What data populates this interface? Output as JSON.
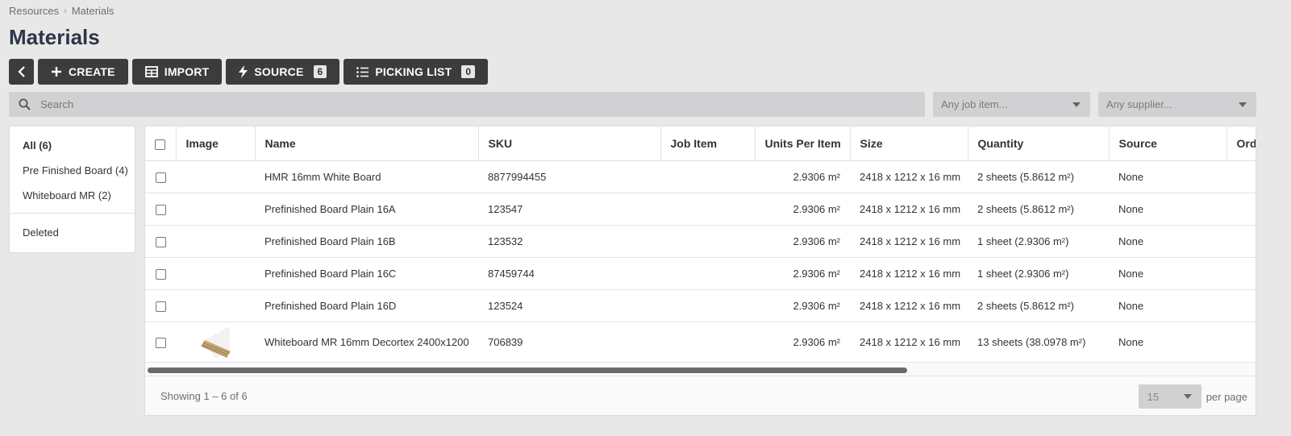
{
  "breadcrumb": {
    "root": "Resources",
    "current": "Materials"
  },
  "page": {
    "title": "Materials"
  },
  "toolbar": {
    "create_label": "CREATE",
    "import_label": "IMPORT",
    "source_label": "SOURCE",
    "source_count": "6",
    "picking_label": "PICKING LIST",
    "picking_count": "0"
  },
  "search": {
    "placeholder": "Search"
  },
  "filters": {
    "job_item": "Any job item...",
    "supplier": "Any supplier..."
  },
  "sidebar": {
    "items": [
      {
        "label": "All (6)"
      },
      {
        "label": "Pre Finished Board (4)"
      },
      {
        "label": "Whiteboard MR (2)"
      }
    ],
    "deleted": "Deleted"
  },
  "table": {
    "columns": [
      "Image",
      "Name",
      "SKU",
      "Job Item",
      "Units Per Item",
      "Size",
      "Quantity",
      "Source",
      "Order"
    ],
    "rows": [
      {
        "name": "HMR 16mm White Board",
        "sku": "8877994455",
        "job_item": "",
        "units": "2.9306 m²",
        "size": "2418 x 1212 x 16 mm",
        "quantity": "2 sheets (5.8612 m²)",
        "source": "None"
      },
      {
        "name": "Prefinished Board Plain 16A",
        "sku": "123547",
        "job_item": "",
        "units": "2.9306 m²",
        "size": "2418 x 1212 x 16 mm",
        "quantity": "2 sheets (5.8612 m²)",
        "source": "None"
      },
      {
        "name": "Prefinished Board Plain 16B",
        "sku": "123532",
        "job_item": "",
        "units": "2.9306 m²",
        "size": "2418 x 1212 x 16 mm",
        "quantity": "1 sheet (2.9306 m²)",
        "source": "None"
      },
      {
        "name": "Prefinished Board Plain 16C",
        "sku": "87459744",
        "job_item": "",
        "units": "2.9306 m²",
        "size": "2418 x 1212 x 16 mm",
        "quantity": "1 sheet (2.9306 m²)",
        "source": "None"
      },
      {
        "name": "Prefinished Board Plain 16D",
        "sku": "123524",
        "job_item": "",
        "units": "2.9306 m²",
        "size": "2418 x 1212 x 16 mm",
        "quantity": "2 sheets (5.8612 m²)",
        "source": "None"
      },
      {
        "name": "Whiteboard MR 16mm Decortex 2400x1200",
        "sku": "706839",
        "job_item": "",
        "units": "2.9306 m²",
        "size": "2418 x 1212 x 16 mm",
        "quantity": "13 sheets (38.0978 m²)",
        "source": "None",
        "image": "board-thumbnail"
      }
    ]
  },
  "footer": {
    "showing": "Showing 1 – 6 of 6",
    "per_page_value": "15",
    "per_page_label": "per page"
  }
}
